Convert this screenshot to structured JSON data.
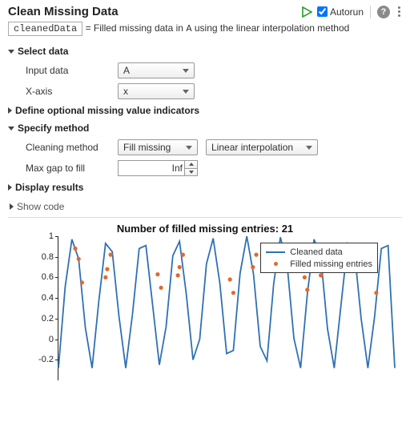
{
  "header": {
    "title": "Clean Missing Data",
    "autorun_label": "Autorun",
    "autorun_checked": true
  },
  "equation": {
    "output_var": "cleanedData",
    "equals": "=",
    "desc_prefix": "Filled missing data in ",
    "data_var": "A",
    "desc_suffix": " using the linear interpolation method"
  },
  "sections": {
    "select_data": {
      "label": "Select data",
      "expanded": true,
      "fields": {
        "input_data": {
          "label": "Input data",
          "value": "A"
        },
        "x_axis": {
          "label": "X-axis",
          "value": "x"
        }
      }
    },
    "missing_indicators": {
      "label": "Define optional missing value indicators",
      "expanded": false
    },
    "specify_method": {
      "label": "Specify method",
      "expanded": true,
      "fields": {
        "cleaning_method": {
          "label": "Cleaning method",
          "value": "Fill missing",
          "interp_value": "Linear interpolation"
        },
        "max_gap": {
          "label": "Max gap to fill",
          "value": "Inf"
        }
      }
    },
    "display_results": {
      "label": "Display results",
      "expanded": false
    },
    "show_code": {
      "label": "Show code",
      "expanded": false
    }
  },
  "chart_data": {
    "type": "line",
    "title": "Number of filled missing entries: 21",
    "ylabel": "",
    "xlabel": "",
    "ylim": [
      -0.4,
      1.0
    ],
    "yticks": [
      -0.2,
      0,
      0.2,
      0.4,
      0.6,
      0.8,
      1
    ],
    "x": [
      0.0,
      0.2,
      0.4,
      0.6,
      0.8,
      1.0,
      1.2,
      1.4,
      1.6,
      1.8,
      2.0,
      2.2,
      2.4,
      2.6,
      2.8,
      3.0,
      3.2,
      3.4,
      3.6,
      3.8,
      4.0,
      4.2,
      4.4,
      4.6,
      4.8,
      5.0,
      5.2,
      5.4,
      5.6,
      5.8,
      6.0,
      6.2,
      6.4,
      6.6,
      6.8,
      7.0,
      7.2,
      7.4,
      7.6,
      7.8,
      8.0,
      8.2,
      8.4,
      8.6,
      8.8,
      9.0,
      9.2,
      9.4,
      9.6,
      9.8,
      10.0
    ],
    "series": [
      {
        "name": "Cleaned data",
        "style": "line",
        "color": "#2f71b2",
        "values": [
          -0.28,
          0.51,
          0.97,
          0.78,
          0.11,
          -0.28,
          0.37,
          0.93,
          0.85,
          0.22,
          -0.28,
          0.24,
          0.88,
          0.91,
          0.33,
          -0.25,
          0.12,
          0.81,
          0.95,
          0.44,
          -0.2,
          0.0,
          0.73,
          0.98,
          0.54,
          -0.14,
          -0.11,
          0.64,
          1.0,
          0.63,
          -0.07,
          -0.21,
          0.54,
          0.99,
          0.72,
          0.01,
          -0.28,
          0.44,
          0.97,
          0.8,
          0.1,
          -0.28,
          0.33,
          0.93,
          0.86,
          0.2,
          -0.28,
          0.22,
          0.88,
          0.91,
          -0.28
        ]
      },
      {
        "name": "Filled missing entries",
        "style": "scatter",
        "color": "#e06a2b",
        "points": [
          {
            "x": 0.5,
            "y": 0.88
          },
          {
            "x": 0.6,
            "y": 0.78
          },
          {
            "x": 0.7,
            "y": 0.55
          },
          {
            "x": 1.4,
            "y": 0.6
          },
          {
            "x": 1.45,
            "y": 0.68
          },
          {
            "x": 1.55,
            "y": 0.82
          },
          {
            "x": 2.95,
            "y": 0.63
          },
          {
            "x": 3.05,
            "y": 0.5
          },
          {
            "x": 3.55,
            "y": 0.62
          },
          {
            "x": 3.6,
            "y": 0.7
          },
          {
            "x": 3.7,
            "y": 0.82
          },
          {
            "x": 5.1,
            "y": 0.58
          },
          {
            "x": 5.2,
            "y": 0.45
          },
          {
            "x": 5.78,
            "y": 0.7
          },
          {
            "x": 5.88,
            "y": 0.82
          },
          {
            "x": 7.32,
            "y": 0.6
          },
          {
            "x": 7.4,
            "y": 0.48
          },
          {
            "x": 7.8,
            "y": 0.62
          },
          {
            "x": 7.9,
            "y": 0.74
          },
          {
            "x": 8.0,
            "y": 0.84
          },
          {
            "x": 9.45,
            "y": 0.45
          }
        ]
      }
    ],
    "legend": {
      "entries": [
        "Cleaned data",
        "Filled missing entries"
      ],
      "position": "top-right"
    }
  }
}
